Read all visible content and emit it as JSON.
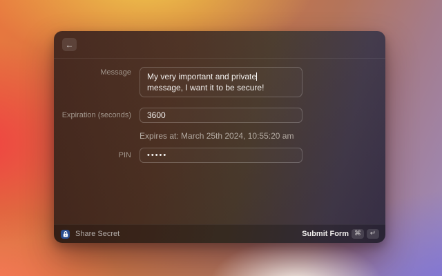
{
  "header": {
    "back_icon": "←"
  },
  "form": {
    "message": {
      "label": "Message",
      "value": "My very important and private message, I want it to be secure!",
      "value_before_caret": "My very important and private",
      "value_after_caret": " message, I want it to be secure!"
    },
    "expiration": {
      "label": "Expiration (seconds)",
      "value": "3600",
      "hint": "Expires at: March 25th 2024, 10:55:20 am"
    },
    "pin": {
      "label": "PIN",
      "masked_value": "•••••"
    }
  },
  "footer": {
    "app_name": "Share Secret",
    "primary_action": "Submit Form",
    "shortcut_keys": [
      "⌘",
      "↵"
    ]
  },
  "colors": {
    "lock_badge_blue": "#2a4d8e",
    "window_left_tint": "#44261c",
    "window_right_tint": "#393048"
  }
}
